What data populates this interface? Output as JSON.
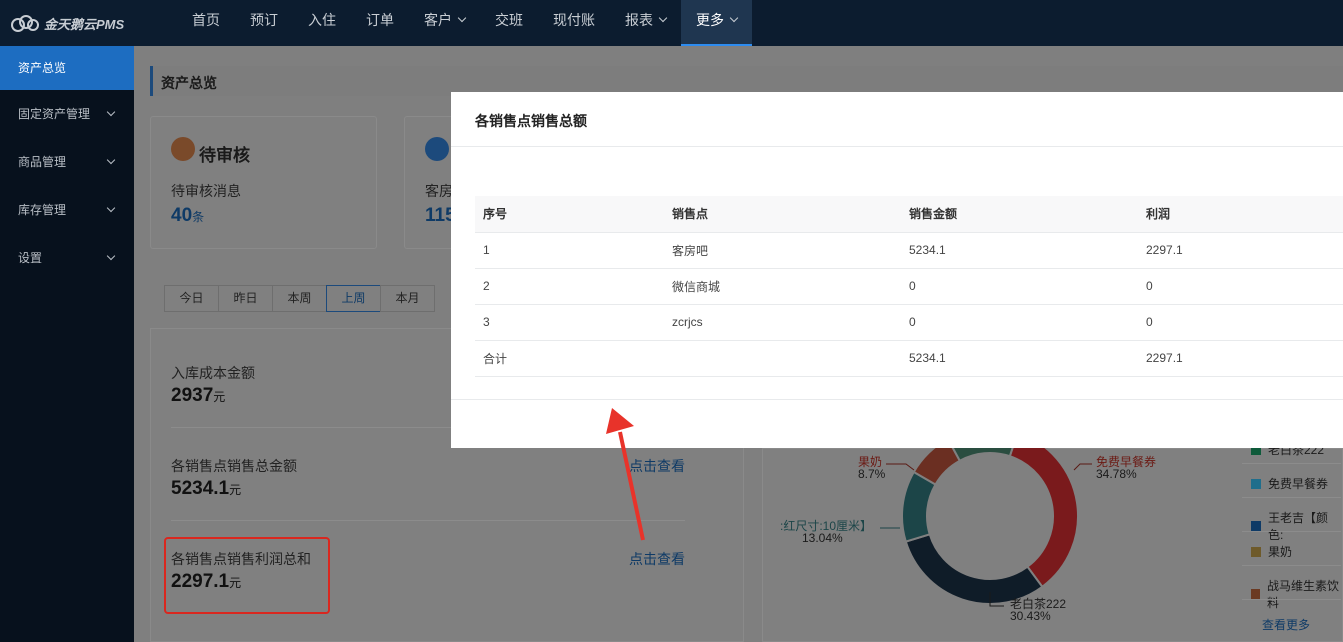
{
  "app": {
    "logo_text": "金天鹅云PMS"
  },
  "nav": {
    "items": [
      {
        "label": "首页",
        "has_menu": false
      },
      {
        "label": "预订",
        "has_menu": false
      },
      {
        "label": "入住",
        "has_menu": false
      },
      {
        "label": "订单",
        "has_menu": false
      },
      {
        "label": "客户",
        "has_menu": true
      },
      {
        "label": "交班",
        "has_menu": false
      },
      {
        "label": "现付账",
        "has_menu": false
      },
      {
        "label": "报表",
        "has_menu": true
      },
      {
        "label": "更多",
        "has_menu": true,
        "active": true
      }
    ]
  },
  "sidebar": {
    "items": [
      {
        "label": "资产总览",
        "active": true
      },
      {
        "label": "固定资产管理"
      },
      {
        "label": "商品管理"
      },
      {
        "label": "库存管理"
      },
      {
        "label": "设置"
      }
    ]
  },
  "page": {
    "title": "资产总览"
  },
  "cards": {
    "pending": {
      "title": "待审核",
      "label": "待审核消息",
      "value": "40",
      "unit": "条"
    },
    "guest": {
      "label": "客房",
      "value": "115"
    }
  },
  "period_tabs": {
    "items": [
      "今日",
      "昨日",
      "本周",
      "上周",
      "本月"
    ],
    "active": "上周"
  },
  "stats": {
    "inbound_cost": {
      "label": "入库成本金额",
      "value": "2937",
      "unit": "元"
    },
    "sales_total": {
      "label": "各销售点销售总金额",
      "value": "5234.1",
      "unit": "元",
      "link": "点击查看"
    },
    "profit_total": {
      "label": "各销售点销售利润总和",
      "value": "2297.1",
      "unit": "元",
      "link": "点击查看"
    }
  },
  "donut": {
    "labels": [
      {
        "name": "果奶",
        "pct": "8.7%"
      },
      {
        "name": "免费早餐券",
        "pct": "34.78%"
      },
      {
        "name": ":红尺寸:10厘米】",
        "pct": "13.04%"
      },
      {
        "name": "老白茶222",
        "pct": "30.43%"
      }
    ],
    "segments": [
      {
        "name": "免费早餐券",
        "value": 34.78,
        "color": "#7a1a1c"
      },
      {
        "name": "老白茶222",
        "value": 30.43,
        "color": "#0f1c28"
      },
      {
        "name": ":红尺寸:10厘米】",
        "value": 13.04,
        "color": "#1c4548"
      },
      {
        "name": "果奶",
        "value": 8.7,
        "color": "#6b2f22"
      },
      {
        "name": "other",
        "value": 13.05,
        "color": "#2a4d40"
      }
    ]
  },
  "legend": {
    "items": [
      {
        "name": "老白茶222",
        "color": "#0e5a3a"
      },
      {
        "name": "免费早餐券",
        "color": "#1f6e8c"
      },
      {
        "name": "王老吉【颜色:",
        "color": "#0e3a66"
      },
      {
        "name": "果奶",
        "color": "#6e5a2a"
      },
      {
        "name": "战马维生素饮料",
        "color": "#6b3a22"
      }
    ],
    "view_more": "查看更多"
  },
  "modal": {
    "title": "各销售点销售总额",
    "columns": [
      "序号",
      "销售点",
      "销售金额",
      "利润"
    ],
    "rows": [
      [
        "1",
        "客房吧",
        "5234.1",
        "2297.1"
      ],
      [
        "2",
        "微信商城",
        "0",
        "0"
      ],
      [
        "3",
        "zcrjcs",
        "0",
        "0"
      ]
    ],
    "total": [
      "合计",
      "",
      "5234.1",
      "2297.1"
    ]
  },
  "colors": {
    "accent": "#2d8cf0",
    "nav_bg": "#0c1c2f",
    "annotation_red": "#e8332a"
  }
}
